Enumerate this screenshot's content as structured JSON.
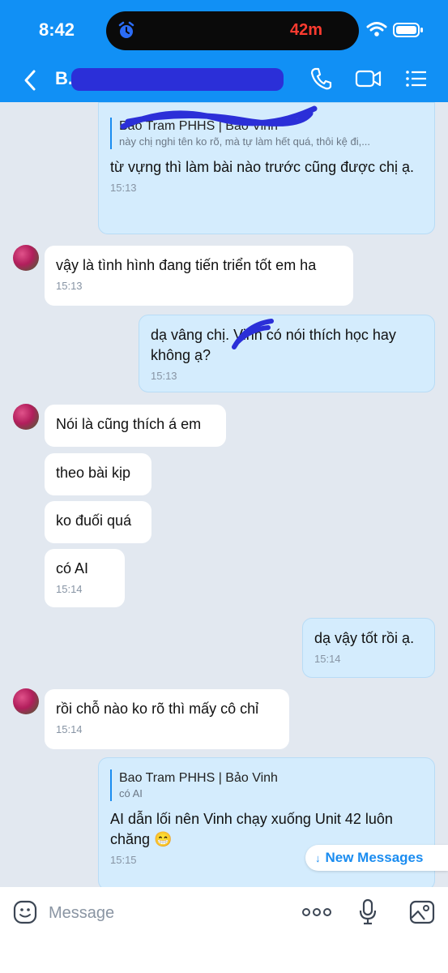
{
  "status_bar": {
    "time": "8:42",
    "island_timer": "42m"
  },
  "header": {
    "title": "B..."
  },
  "colors": {
    "header": "#1190f5",
    "outgoing": "#d4ecfd",
    "incoming": "#ffffff",
    "background": "#e2e8f0",
    "accent": "#1a8cf0"
  },
  "messages": [
    {
      "direction": "out",
      "quote_name": "Bao Tram PHHS | Bảo Vinh",
      "quote_text": "này chị nghi tên ko rõ, mà tự làm hết quá, thôi kệ đi,...",
      "text": "từ vựng thì làm bài nào trước cũng được chị ạ.",
      "time": "15:13"
    },
    {
      "direction": "in",
      "text": "vậy là tình hình đang tiến triển tốt em ha",
      "time": "15:13"
    },
    {
      "direction": "out",
      "text": "dạ vâng chị. Vinh có nói thích học hay không ạ?",
      "time": "15:13"
    },
    {
      "direction": "in",
      "text": "Nói là cũng thích á em"
    },
    {
      "direction": "in",
      "text": "theo bài kịp"
    },
    {
      "direction": "in",
      "text": "ko đuối quá"
    },
    {
      "direction": "in",
      "text": "có AI",
      "time": "15:14"
    },
    {
      "direction": "out",
      "text": "dạ vậy tốt rồi ạ.",
      "time": "15:14"
    },
    {
      "direction": "in",
      "text": "rồi chỗ nào ko rõ thì mấy cô chỉ",
      "time": "15:14"
    },
    {
      "direction": "out",
      "quote_name": "Bao Tram PHHS | Bảo Vinh",
      "quote_text": "có AI",
      "text": "AI dẫn lối nên Vinh chạy xuống Unit 42 luôn chăng 😁",
      "time": "15:15"
    }
  ],
  "new_messages_label": "New Messages",
  "input": {
    "placeholder": "Message"
  },
  "icons": {
    "back": "chevron-left-icon",
    "call": "phone-icon",
    "video": "video-camera-icon",
    "menu": "list-icon",
    "sticker": "emoji-face-icon",
    "more": "more-dots-icon",
    "voice": "microphone-icon",
    "image": "image-icon"
  }
}
